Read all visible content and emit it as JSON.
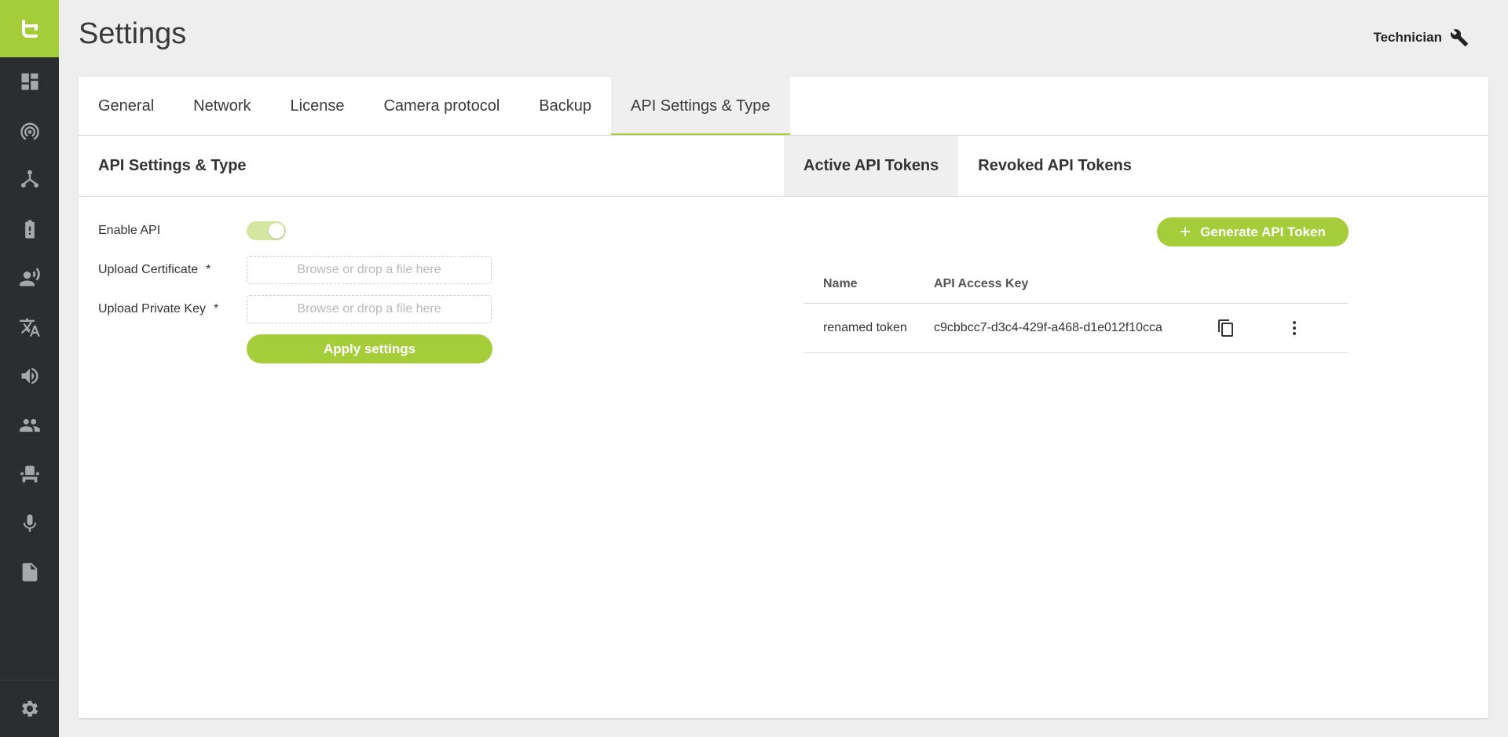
{
  "app": {
    "page_title": "Settings",
    "user_role": "Technician",
    "accent": "#a4cd39"
  },
  "sidebar": {
    "items": [
      {
        "icon": "dashboard-icon"
      },
      {
        "icon": "broadcast-icon"
      },
      {
        "icon": "network-icon"
      },
      {
        "icon": "battery-alert-icon"
      },
      {
        "icon": "speaker-person-icon"
      },
      {
        "icon": "translate-icon"
      },
      {
        "icon": "volume-icon"
      },
      {
        "icon": "people-icon"
      },
      {
        "icon": "seat-icon"
      },
      {
        "icon": "microphone-icon"
      },
      {
        "icon": "document-icon"
      }
    ],
    "bottom": {
      "icon": "gear-icon"
    }
  },
  "tabs": [
    {
      "label": "General"
    },
    {
      "label": "Network"
    },
    {
      "label": "License"
    },
    {
      "label": "Camera protocol"
    },
    {
      "label": "Backup"
    },
    {
      "label": "API Settings & Type",
      "active": true
    }
  ],
  "section": {
    "title": "API Settings & Type",
    "token_tabs": [
      {
        "label": "Active API Tokens",
        "active": true
      },
      {
        "label": "Revoked API Tokens"
      }
    ]
  },
  "form": {
    "enable_api_label": "Enable API",
    "enable_api_on": true,
    "cert_label": "Upload Certificate",
    "key_label": "Upload Private Key",
    "required_mark": "*",
    "drop_placeholder": "Browse or drop a file here",
    "apply_label": "Apply settings"
  },
  "tokens": {
    "generate_label": "Generate API Token",
    "generate_icon": "+",
    "columns": {
      "name": "Name",
      "key": "API Access Key"
    },
    "rows": [
      {
        "name": "renamed token",
        "key": "c9cbbcc7-d3c4-429f-a468-d1e012f10cca"
      }
    ]
  }
}
